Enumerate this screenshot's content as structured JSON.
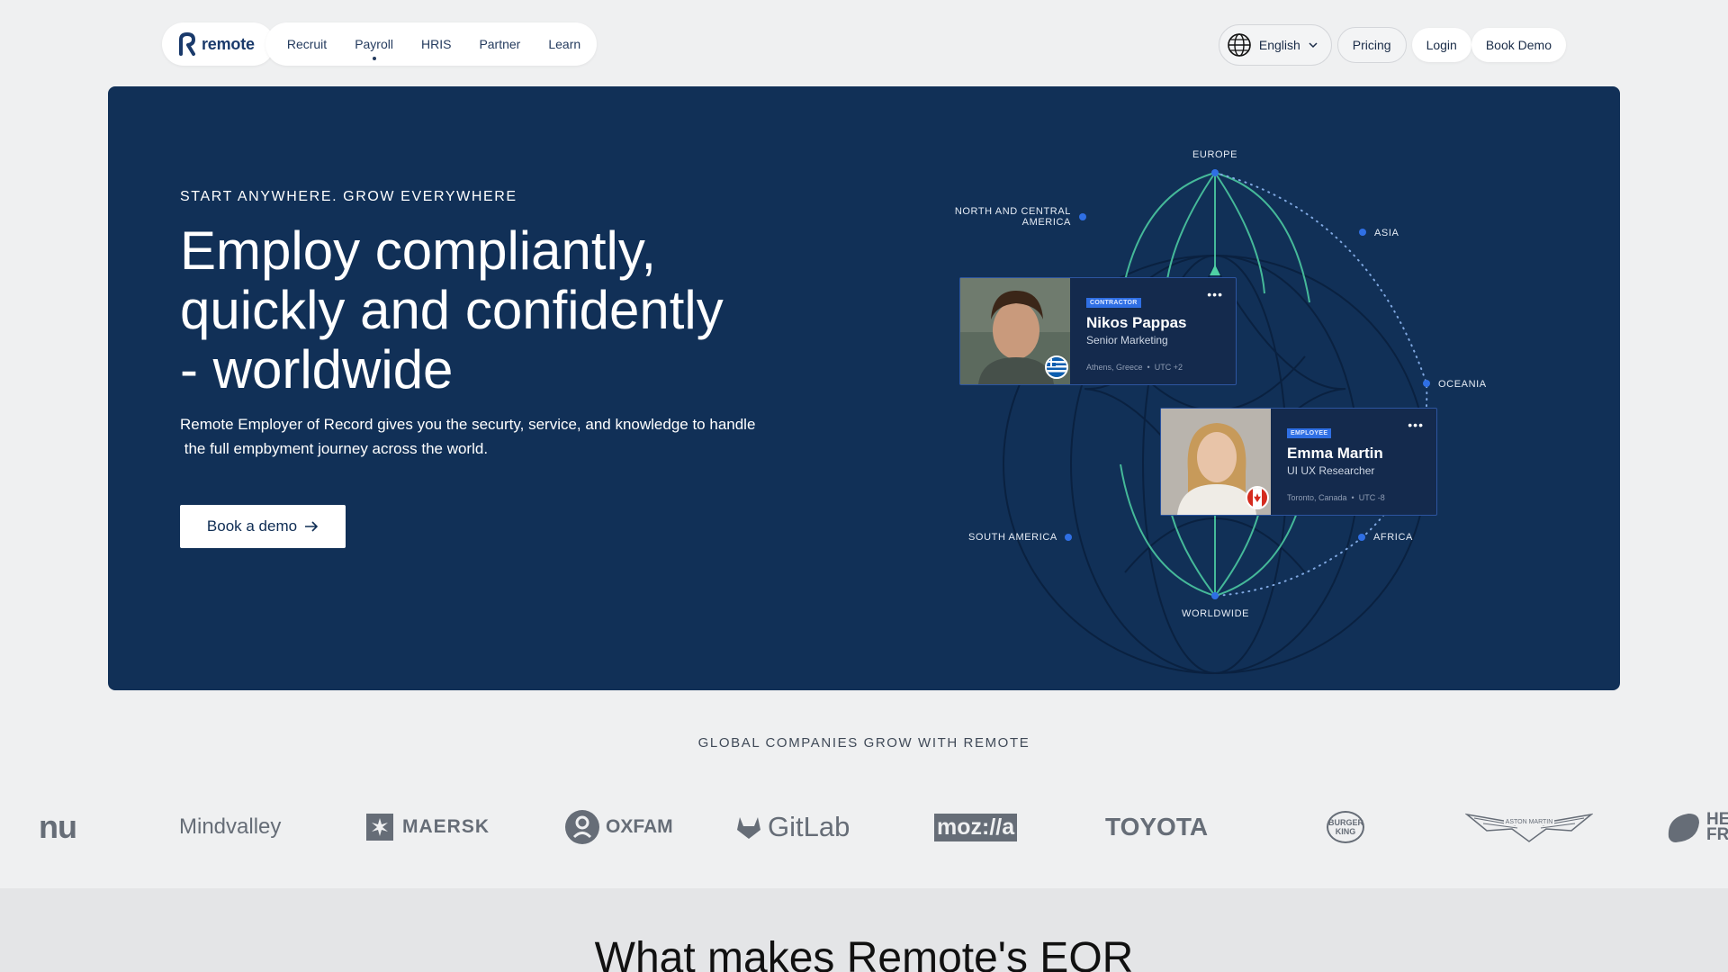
{
  "nav": {
    "logo_text": "remote",
    "menu": [
      {
        "label": "Recruit"
      },
      {
        "label": "Payroll"
      },
      {
        "label": "HRIS"
      },
      {
        "label": "Partner"
      },
      {
        "label": "Learn"
      }
    ],
    "language": "English",
    "pricing": "Pricing",
    "login": "Login",
    "book_demo": "Book Demo"
  },
  "hero": {
    "eyebrow": "START ANYWHERE. GROW EVERYWHERE",
    "headline": [
      "Employ compliantly,",
      "quickly and confidently",
      "- worldwide"
    ],
    "subtext": [
      "Remote Employer of Record gives you the securty, service, and knowledge to handle",
      " the full empbyment journey across the world."
    ],
    "cta": "Book a demo",
    "regions": {
      "europe": "EUROPE",
      "north_america": [
        "NORTH AND CENTRAL",
        "AMERICA"
      ],
      "asia": "ASIA",
      "oceania": "OCEANIA",
      "south_america": "SOUTH AMERICA",
      "africa": "AFRICA",
      "worldwide": "WORLDWIDE"
    },
    "cards": [
      {
        "badge": "CONTRACTOR",
        "name": "Nikos Pappas",
        "role": "Senior Marketing",
        "location": "Athens, Greece",
        "timezone": "UTC +2"
      },
      {
        "badge": "EMPLOYEE",
        "name": "Emma Martin",
        "role": "UI UX Researcher",
        "location": "Toronto, Canada",
        "timezone": "UTC -8"
      }
    ]
  },
  "logos": {
    "title": "GLOBAL COMPANIES GROW WITH REMOTE",
    "items": [
      "nu",
      "Mindvalley",
      "MAERSK",
      "OXFAM",
      "GitLab",
      "moz://a",
      "TOYOTA",
      "BURGER KING",
      "ASTON MARTIN",
      "HE FR"
    ]
  },
  "section2": {
    "title": "What makes Remote's EOR"
  },
  "colors": {
    "hero_bg": "#113057",
    "accent_green": "#4fd1a5",
    "badge_blue": "#2f6fe4",
    "page_bg": "#eff0f1"
  }
}
